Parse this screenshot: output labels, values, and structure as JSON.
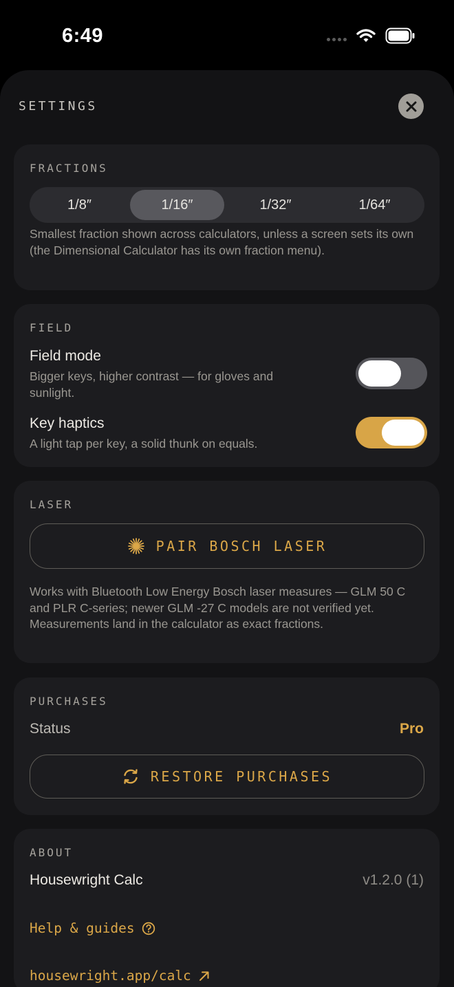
{
  "status_bar": {
    "time": "6:49"
  },
  "sheet": {
    "title": "SETTINGS"
  },
  "fractions": {
    "label": "FRACTIONS",
    "options": [
      "1/8″",
      "1/16″",
      "1/32″",
      "1/64″"
    ],
    "selected": "1/16″",
    "description": "Smallest fraction shown across calculators, unless a screen sets its own (the Dimensional Calculator has its own fraction menu)."
  },
  "field": {
    "label": "FIELD",
    "field_mode": {
      "title": "Field mode",
      "description": "Bigger keys, higher contrast — for gloves and sunlight.",
      "enabled": false
    },
    "key_haptics": {
      "title": "Key haptics",
      "description": "A light tap per key, a solid thunk on equals.",
      "enabled": true
    }
  },
  "laser": {
    "label": "LASER",
    "pair_button": "PAIR BOSCH LASER",
    "description": "Works with Bluetooth Low Energy Bosch laser measures — GLM 50 C and PLR C-series; newer GLM -27 C models are not verified yet. Measurements land in the calculator as exact fractions."
  },
  "purchases": {
    "label": "PURCHASES",
    "status_key": "Status",
    "status_value": "Pro",
    "restore_button": "RESTORE PURCHASES"
  },
  "about": {
    "label": "ABOUT",
    "app_name": "Housewright Calc",
    "version": "v1.2.0 (1)",
    "help_link": "Help & guides",
    "site_link": "housewright.app/calc"
  },
  "colors": {
    "accent": "#dba748",
    "toggle_on": "#d8a547",
    "card_bg": "#1c1c1f",
    "sheet_bg": "#131315"
  },
  "icons": {
    "close": "close-icon",
    "laser": "starburst-icon",
    "restore": "refresh-icon",
    "help": "help-circle-icon",
    "external": "arrow-up-right-icon"
  }
}
